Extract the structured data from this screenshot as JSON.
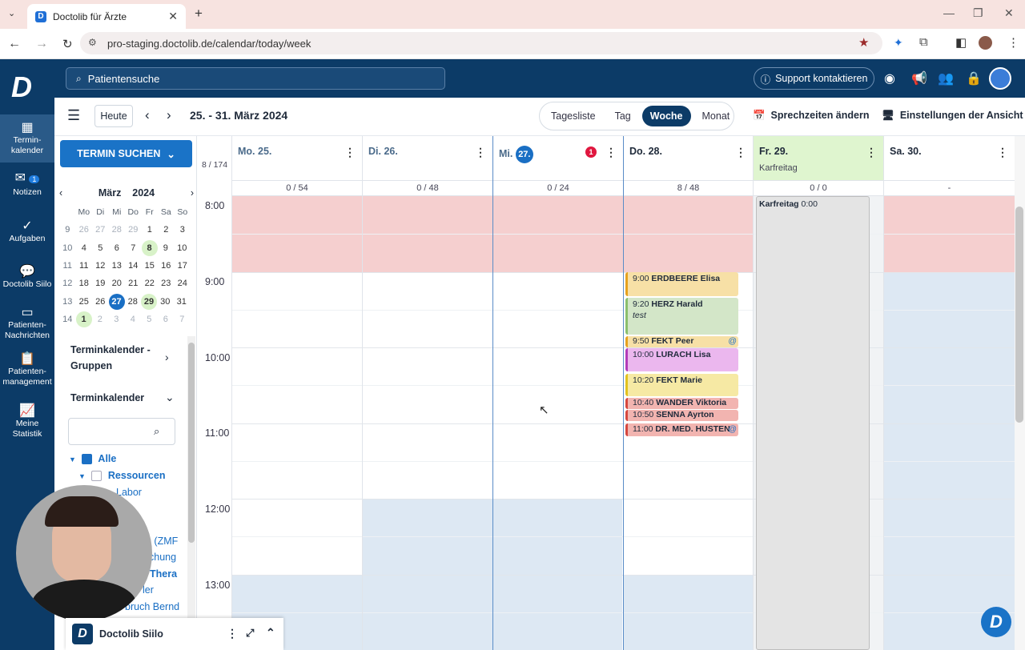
{
  "browser": {
    "tab_title": "Doctolib für Ärzte",
    "url": "pro-staging.doctolib.de/calendar/today/week"
  },
  "header": {
    "search_placeholder": "Patientensuche",
    "support_label": "Support kontaktieren"
  },
  "nav": {
    "items": [
      {
        "label": "Termin-\nkalender",
        "icon": "calendar-icon"
      },
      {
        "label": "Notizen",
        "icon": "notes-icon",
        "badge": "1"
      },
      {
        "label": "Aufgaben",
        "icon": "check-icon"
      },
      {
        "label": "Doctolib Siilo",
        "icon": "chat-icon"
      },
      {
        "label": "Patienten-\nNachrichten",
        "icon": "message-icon"
      },
      {
        "label": "Patienten-\nmanagement",
        "icon": "clipboard-icon"
      },
      {
        "label": "Meine Statistik",
        "icon": "chart-icon"
      }
    ]
  },
  "toolbar": {
    "today_label": "Heute",
    "date_range": "25. - 31. März 2024",
    "views": [
      "Tagesliste",
      "Tag",
      "Woche",
      "Monat"
    ],
    "active_view": "Woche",
    "sprechzeiten_label": "Sprechzeiten ändern",
    "einstellungen_label": "Einstellungen der Ansicht"
  },
  "sidebar": {
    "termin_suchen": "TERMIN SUCHEN",
    "month": "März",
    "year": "2024",
    "weekday_headers": [
      "Mo",
      "Di",
      "Mi",
      "Do",
      "Fr",
      "Sa",
      "So"
    ],
    "weeks": [
      {
        "wk": "9",
        "days": [
          "26",
          "27",
          "28",
          "29",
          "1",
          "2",
          "3"
        ]
      },
      {
        "wk": "10",
        "days": [
          "4",
          "5",
          "6",
          "7",
          "8",
          "9",
          "10"
        ]
      },
      {
        "wk": "11",
        "days": [
          "11",
          "12",
          "13",
          "14",
          "15",
          "16",
          "17"
        ]
      },
      {
        "wk": "12",
        "days": [
          "18",
          "19",
          "20",
          "21",
          "22",
          "23",
          "24"
        ]
      },
      {
        "wk": "13",
        "days": [
          "25",
          "26",
          "27",
          "28",
          "29",
          "30",
          "31"
        ]
      },
      {
        "wk": "14",
        "days": [
          "1",
          "2",
          "3",
          "4",
          "5",
          "6",
          "7"
        ]
      }
    ],
    "groups_label": "Terminkalender - Gruppen",
    "calendars_label": "Terminkalender",
    "tree": {
      "all": "Alle",
      "resources": "Ressourcen",
      "labor": "Labor",
      "partial": [
        "e (ZMF",
        "chung",
        "Thera",
        "ler",
        "bruch Bernd"
      ]
    }
  },
  "calendar": {
    "total_count": "8 / 174",
    "days": [
      {
        "label": "Mo. 25.",
        "count": "0 / 54"
      },
      {
        "label": "Di. 26.",
        "count": "0 / 48"
      },
      {
        "label": "Mi.",
        "day_num": "27.",
        "alert": "1",
        "count": "0 / 24"
      },
      {
        "label": "Do. 28.",
        "count": "8 / 48"
      },
      {
        "label": "Fr. 29.",
        "sub": "Karfreitag",
        "count": "0 / 0"
      },
      {
        "label": "Sa. 30.",
        "count": "-"
      }
    ],
    "hours": [
      "8:00",
      "9:00",
      "10:00",
      "11:00",
      "12:00",
      "13:00"
    ],
    "holiday_block": {
      "title": "Karfreitag",
      "time": "0:00"
    },
    "appointments": [
      {
        "time": "9:00",
        "name": "ERDBEERE Elisa",
        "color": "#f7e0a6",
        "bar": "#e6a21f"
      },
      {
        "time": "9:20",
        "name": "HERZ Harald",
        "note": "test",
        "color": "#d3e6c8",
        "bar": "#8bbf6d"
      },
      {
        "time": "9:50",
        "name": "FEKT Peer",
        "color": "#f7e0a6",
        "bar": "#e6a21f",
        "flag": "@"
      },
      {
        "time": "10:00",
        "name": "LURACH Lisa",
        "color": "#ebb7ee",
        "bar": "#b23bb9"
      },
      {
        "time": "10:20",
        "name": "FEKT Marie",
        "color": "#f6e9a4",
        "bar": "#e2c21f"
      },
      {
        "time": "10:40",
        "name": "WANDER Viktoria",
        "color": "#f2b4b0",
        "bar": "#d6473f"
      },
      {
        "time": "10:50",
        "name": "SENNA Ayrton",
        "color": "#f2b4b0",
        "bar": "#d6473f"
      },
      {
        "time": "11:00",
        "name": "DR. MED. HUSTEN",
        "color": "#f2b4b0",
        "bar": "#d6473f",
        "flag": "@"
      }
    ]
  },
  "siilo_bar": {
    "label": "Doctolib Siilo",
    "logo_sub": "Siilo"
  },
  "colors": {
    "primary": "#0c3b67",
    "accent": "#1a73c7",
    "blocked": "#f5cfcf",
    "holiday": "#dff5cf",
    "offhours": "#dde8f3"
  }
}
